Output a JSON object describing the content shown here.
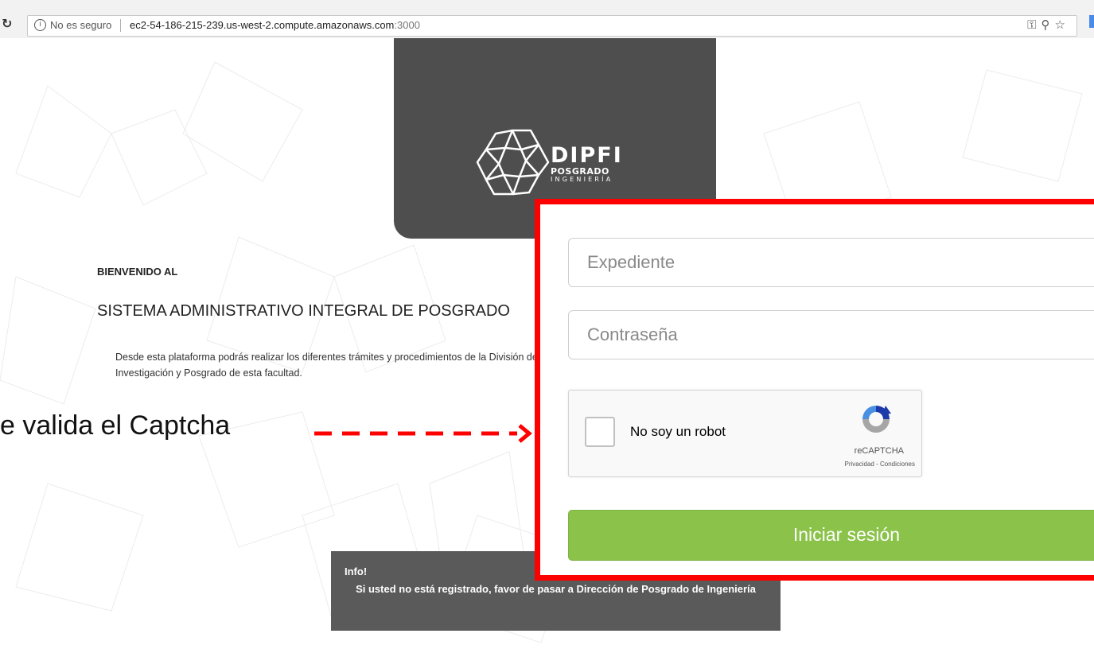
{
  "browser": {
    "security_label": "No es seguro",
    "address_host": "ec2-54-186-215-239.us-west-2.compute.amazonaws.com",
    "address_port": ":3000",
    "info_icon": "info-icon",
    "icons": [
      "key-icon",
      "zoom-icon",
      "star-icon"
    ]
  },
  "logo": {
    "title": "DIPFI",
    "subtitle": "POSGRADO",
    "subtitle2": "INGENIERÍA"
  },
  "intro": {
    "welcome": "BIENVENIDO AL",
    "system_title": "SISTEMA ADMINISTRATIVO INTEGRAL DE POSGRADO",
    "description": "Desde esta plataforma podrás realizar los diferentes trámites y procedimientos de la División de Investigación y Posgrado de esta facultad."
  },
  "annotation": {
    "text": "e valida el Captcha",
    "color": "#ff0000"
  },
  "login": {
    "expediente_placeholder": "Expediente",
    "password_placeholder": "Contraseña",
    "captcha_label": "No soy un robot",
    "captcha_brand": "reCAPTCHA",
    "captcha_terms": "Privacidad - Condiciones",
    "submit_label": "Iniciar sesión",
    "submit_color": "#8bc34a",
    "highlight_color": "#ff0000"
  },
  "info": {
    "label": "Info!",
    "message": "Si usted no está registrado, favor de pasar a Dirección de Posgrado de Ingeniería"
  }
}
